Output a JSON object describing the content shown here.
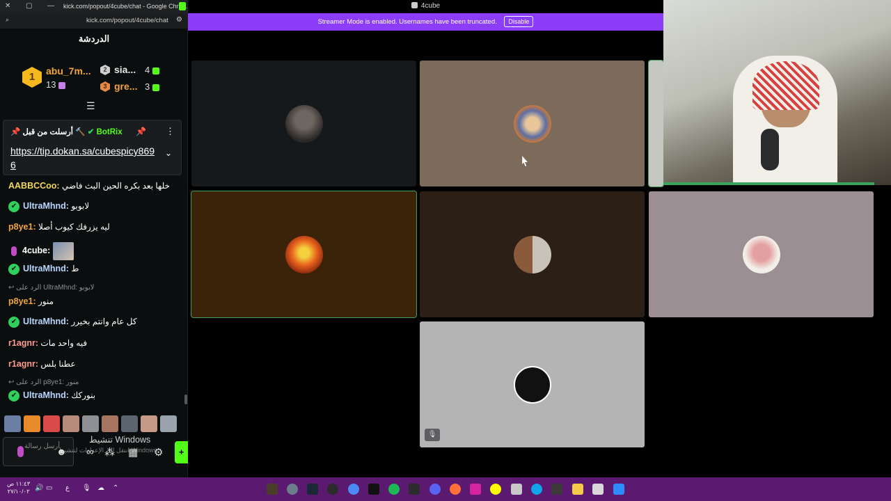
{
  "chat_window": {
    "title": "kick.com/popout/4cube/chat - Google Chro...",
    "url": "kick.com/popout/4cube/chat",
    "heading": "الدردشة"
  },
  "leaderboard": [
    {
      "rank": "1",
      "user": "abu_7m...",
      "count": "13"
    },
    {
      "rank": "2",
      "user": "sia...",
      "count": "4"
    },
    {
      "rank": "3",
      "user": "gre...",
      "count": "3"
    }
  ],
  "pinned": {
    "label": "أرسلت من قبل",
    "user": "BotRix",
    "link": "https://tip.dokan.sa/cubespicy8696"
  },
  "messages": [
    {
      "user": "AABBCCoo:",
      "text": "خلها بعد بكره الحين البث فاضي",
      "color": "#f3d75c",
      "verified": false
    },
    {
      "user": "UltraMhnd:",
      "text": "لابوبو",
      "color": "#b9d6ff",
      "verified": true
    },
    {
      "user": "p8ye1:",
      "text": "ليه يزرفك كيوب أصلا",
      "color": "#f2a43a",
      "verified": false
    },
    {
      "user": "4cube:",
      "text": "",
      "color": "#fff",
      "verified": false
    },
    {
      "user": "UltraMhnd:",
      "text": "ط",
      "color": "#b9d6ff",
      "verified": true
    },
    {
      "user": "p8ye1:",
      "text": "منور",
      "color": "#f2a43a",
      "verified": false
    },
    {
      "user": "UltraMhnd:",
      "text": "كل عام وانتم بخيرر",
      "color": "#b9d6ff",
      "verified": true
    },
    {
      "user": "r1agnr:",
      "text": "فيه واحد مات",
      "color": "#ff9a8b",
      "verified": false
    },
    {
      "user": "r1agnr:",
      "text": "عطنا بلس",
      "color": "#ff9a8b",
      "verified": false
    },
    {
      "user": "UltraMhnd:",
      "text": "بنوركك",
      "color": "#b9d6ff",
      "verified": true
    }
  ],
  "replies": [
    "الرد على UltraMhnd: لابوبو",
    "الرد على p8ye1: منور"
  ],
  "input": {
    "placeholder": "أرسل رسالة",
    "send": "+"
  },
  "windows_watermark": {
    "line1": "تنشيط Windows",
    "line2": "انتقل إلى الإعدادات لتنشيط Windows."
  },
  "call": {
    "title": "4cube",
    "banner": "Streamer Mode is enabled. Usernames have been truncated.",
    "banner_button": "Disable"
  },
  "taskbar": {
    "time": "١١:٤٣ ص",
    "date": "٢٧/١٠/٠٢",
    "lang": "ع"
  },
  "colors": {
    "kick_green": "#53fc18",
    "discord_purple": "#8b3dfa",
    "speaking_green": "#3ba55d",
    "taskbar": "#5b1a70"
  }
}
